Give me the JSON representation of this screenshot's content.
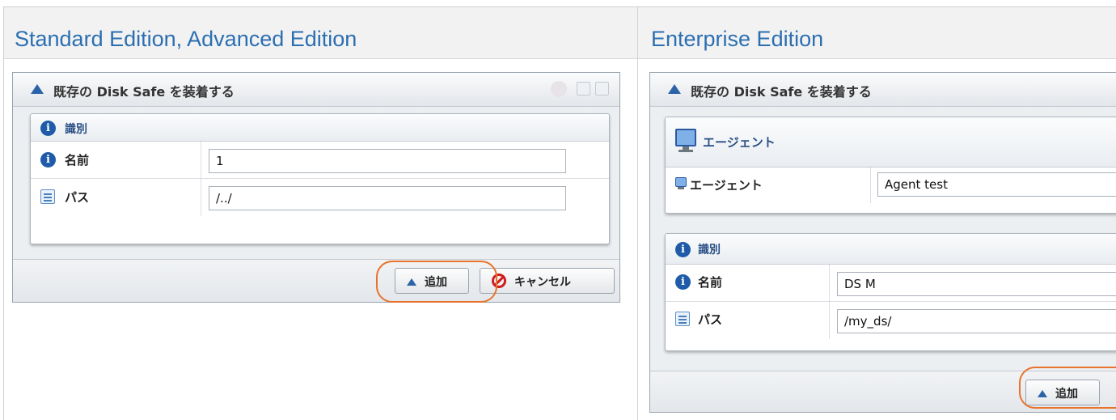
{
  "columns": {
    "left_heading": "Standard Edition, Advanced Edition",
    "right_heading": "Enterprise Edition"
  },
  "left_dialog": {
    "title": "既存の Disk Safe を装着する",
    "section_label": "識別",
    "name_label": "名前",
    "name_value": "1",
    "path_label": "パス",
    "path_value": "/../",
    "add_button": "追加",
    "cancel_button": "キャンセル"
  },
  "right_dialog": {
    "title": "既存の Disk Safe を装着する",
    "agent_section_label": "エージェント",
    "agent_label": "エージェント",
    "agent_value": "Agent test",
    "section_label": "識別",
    "name_label": "名前",
    "name_value": "DS M",
    "path_label": "パス",
    "path_value": "/my_ds/",
    "add_button": "追加"
  },
  "icons": {
    "title": "triangle-up-icon",
    "info": "info-icon",
    "path": "path-icon",
    "agent": "monitor-icon",
    "cancel": "cancel-icon"
  },
  "colors": {
    "heading_text": "#2c6fb1",
    "highlight": "#e8732c",
    "icon_blue": "#2b63a9"
  }
}
